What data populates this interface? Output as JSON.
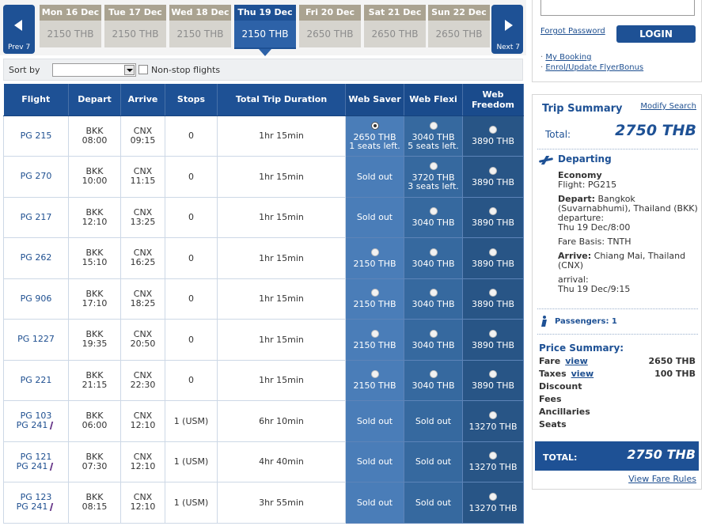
{
  "nav": {
    "prev_label": "Prev 7",
    "next_label": "Next 7"
  },
  "days": [
    {
      "name": "Mon 16 Dec",
      "price": "2150 THB",
      "selected": false
    },
    {
      "name": "Tue 17 Dec",
      "price": "2150 THB",
      "selected": false
    },
    {
      "name": "Wed 18 Dec",
      "price": "2150 THB",
      "selected": false
    },
    {
      "name": "Thu 19 Dec",
      "price": "2150 THB",
      "selected": true
    },
    {
      "name": "Fri 20 Dec",
      "price": "2650 THB",
      "selected": false
    },
    {
      "name": "Sat 21 Dec",
      "price": "2650 THB",
      "selected": false
    },
    {
      "name": "Sun 22 Dec",
      "price": "2650 THB",
      "selected": false
    }
  ],
  "sortbar": {
    "sort_label": "Sort by",
    "sort_value": "",
    "nonstop_label": "Non-stop flights",
    "nonstop_checked": false
  },
  "table": {
    "headers": {
      "flight": "Flight",
      "depart": "Depart",
      "arrive": "Arrive",
      "stops": "Stops",
      "duration": "Total Trip Duration",
      "saver": "Web Saver",
      "flexi": "Web Flexi",
      "freedom_1": "Web",
      "freedom_2": "Freedom"
    },
    "sold_out": "Sold out",
    "rows": [
      {
        "flights": [
          "PG 215"
        ],
        "partner": false,
        "dep_code": "BKK",
        "dep_time": "08:00",
        "arr_code": "CNX",
        "arr_time": "09:15",
        "stops": "0",
        "duration": "1hr 15min",
        "saver": {
          "available": true,
          "checked": true,
          "price": "2650 THB",
          "note": "1 seats left."
        },
        "flexi": {
          "available": true,
          "checked": false,
          "price": "3040 THB",
          "note": "5 seats left."
        },
        "freedom": {
          "available": true,
          "checked": false,
          "price": "3890 THB",
          "note": ""
        }
      },
      {
        "flights": [
          "PG 270"
        ],
        "partner": false,
        "dep_code": "BKK",
        "dep_time": "10:00",
        "arr_code": "CNX",
        "arr_time": "11:15",
        "stops": "0",
        "duration": "1hr 15min",
        "saver": {
          "available": false
        },
        "flexi": {
          "available": true,
          "checked": false,
          "price": "3720 THB",
          "note": "3 seats left."
        },
        "freedom": {
          "available": true,
          "checked": false,
          "price": "3890 THB",
          "note": ""
        }
      },
      {
        "flights": [
          "PG 217"
        ],
        "partner": false,
        "dep_code": "BKK",
        "dep_time": "12:10",
        "arr_code": "CNX",
        "arr_time": "13:25",
        "stops": "0",
        "duration": "1hr 15min",
        "saver": {
          "available": false
        },
        "flexi": {
          "available": true,
          "checked": false,
          "price": "3040 THB",
          "note": ""
        },
        "freedom": {
          "available": true,
          "checked": false,
          "price": "3890 THB",
          "note": ""
        }
      },
      {
        "flights": [
          "PG 262"
        ],
        "partner": false,
        "dep_code": "BKK",
        "dep_time": "15:10",
        "arr_code": "CNX",
        "arr_time": "16:25",
        "stops": "0",
        "duration": "1hr 15min",
        "saver": {
          "available": true,
          "checked": false,
          "price": "2150 THB",
          "note": ""
        },
        "flexi": {
          "available": true,
          "checked": false,
          "price": "3040 THB",
          "note": ""
        },
        "freedom": {
          "available": true,
          "checked": false,
          "price": "3890 THB",
          "note": ""
        }
      },
      {
        "flights": [
          "PG 906"
        ],
        "partner": false,
        "dep_code": "BKK",
        "dep_time": "17:10",
        "arr_code": "CNX",
        "arr_time": "18:25",
        "stops": "0",
        "duration": "1hr 15min",
        "saver": {
          "available": true,
          "checked": false,
          "price": "2150 THB",
          "note": ""
        },
        "flexi": {
          "available": true,
          "checked": false,
          "price": "3040 THB",
          "note": ""
        },
        "freedom": {
          "available": true,
          "checked": false,
          "price": "3890 THB",
          "note": ""
        }
      },
      {
        "flights": [
          "PG 1227"
        ],
        "partner": false,
        "dep_code": "BKK",
        "dep_time": "19:35",
        "arr_code": "CNX",
        "arr_time": "20:50",
        "stops": "0",
        "duration": "1hr 15min",
        "saver": {
          "available": true,
          "checked": false,
          "price": "2150 THB",
          "note": ""
        },
        "flexi": {
          "available": true,
          "checked": false,
          "price": "3040 THB",
          "note": ""
        },
        "freedom": {
          "available": true,
          "checked": false,
          "price": "3890 THB",
          "note": ""
        }
      },
      {
        "flights": [
          "PG 221"
        ],
        "partner": false,
        "dep_code": "BKK",
        "dep_time": "21:15",
        "arr_code": "CNX",
        "arr_time": "22:30",
        "stops": "0",
        "duration": "1hr 15min",
        "saver": {
          "available": true,
          "checked": false,
          "price": "2150 THB",
          "note": ""
        },
        "flexi": {
          "available": true,
          "checked": false,
          "price": "3040 THB",
          "note": ""
        },
        "freedom": {
          "available": true,
          "checked": false,
          "price": "3890 THB",
          "note": ""
        }
      },
      {
        "flights": [
          "PG 103",
          "PG 241"
        ],
        "partner": true,
        "dep_code": "BKK",
        "dep_time": "06:00",
        "arr_code": "CNX",
        "arr_time": "12:10",
        "stops": "1 (USM)",
        "duration": "6hr 10min",
        "saver": {
          "available": false
        },
        "flexi": {
          "available": false
        },
        "freedom": {
          "available": true,
          "checked": false,
          "price": "13270 THB",
          "note": ""
        }
      },
      {
        "flights": [
          "PG 121",
          "PG 241"
        ],
        "partner": true,
        "dep_code": "BKK",
        "dep_time": "07:30",
        "arr_code": "CNX",
        "arr_time": "12:10",
        "stops": "1 (USM)",
        "duration": "4hr 40min",
        "saver": {
          "available": false
        },
        "flexi": {
          "available": false
        },
        "freedom": {
          "available": true,
          "checked": false,
          "price": "13270 THB",
          "note": ""
        }
      },
      {
        "flights": [
          "PG 123",
          "PG 241"
        ],
        "partner": true,
        "dep_code": "BKK",
        "dep_time": "08:15",
        "arr_code": "CNX",
        "arr_time": "12:10",
        "stops": "1 (USM)",
        "duration": "3hr 55min",
        "saver": {
          "available": false
        },
        "flexi": {
          "available": false
        },
        "freedom": {
          "available": true,
          "checked": false,
          "price": "13270 THB",
          "note": ""
        }
      }
    ]
  },
  "login": {
    "input_value": "",
    "forgot_password": "Forgot Password",
    "login_button": "LOGIN",
    "links": [
      "My Booking",
      "Enrol/Update FlyerBonus"
    ]
  },
  "summary": {
    "title": "Trip Summary",
    "modify_link": "Modify Search",
    "total_label": "Total:",
    "total_amount": "2750 THB",
    "departing_label": "Departing",
    "cabin": "Economy",
    "flight_line": "Flight: PG215",
    "depart_label": "Depart:",
    "depart_place": "Bangkok (Suvarnabhumi), Thailand (BKK)",
    "departure_label": "departure:",
    "departure_time": "Thu 19 Dec/8:00",
    "fare_basis": "Fare Basis: TNTH",
    "arrive_label": "Arrive:",
    "arrive_place": "Chiang Mai, Thailand (CNX)",
    "arrival_label": "arrival:",
    "arrival_time": "Thu 19 Dec/9:15",
    "passengers": "Passengers: 1",
    "price_summary": "Price Summary:",
    "price_rows": [
      {
        "label": "Fare",
        "link": "view",
        "amount": "2650 THB"
      },
      {
        "label": "Taxes",
        "link": "view",
        "amount": "100 THB"
      },
      {
        "label": "Discount",
        "link": "",
        "amount": ""
      },
      {
        "label": "Fees",
        "link": "",
        "amount": ""
      },
      {
        "label": "Ancillaries",
        "link": "",
        "amount": ""
      },
      {
        "label": "Seats",
        "link": "",
        "amount": ""
      }
    ],
    "grand_total_label": "TOTAL:",
    "grand_total_amount": "2750 THB",
    "fare_rules_link": "View Fare Rules"
  },
  "colors": {
    "brand_blue": "#1e5195",
    "day_header": "#aaa391",
    "saver_bg": "#4a7db8",
    "flexi_bg": "#36699f",
    "freedom_bg": "#285586"
  }
}
